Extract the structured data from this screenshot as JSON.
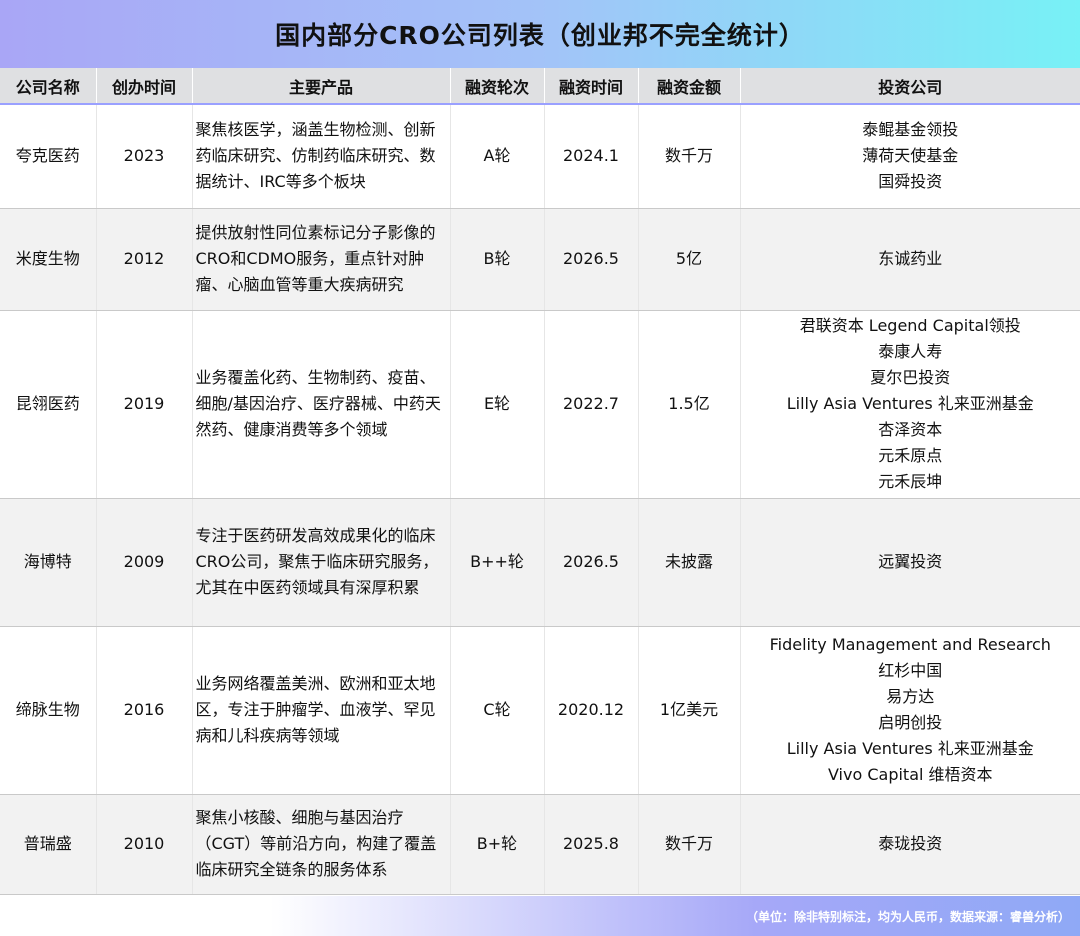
{
  "title": "国内部分CRO公司列表（创业邦不完全统计）",
  "headers": [
    "公司名称",
    "创办时间",
    "主要产品",
    "融资轮次",
    "融资时间",
    "融资金额",
    "投资公司"
  ],
  "rows": [
    {
      "company": "夸克医药",
      "founded": "2023",
      "product": "聚焦核医学，涵盖生物检测、创新药临床研究、仿制药临床研究、数据统计、IRC等多个板块",
      "round": "A轮",
      "date": "2024.1",
      "amount": "数千万",
      "investors": [
        "泰鲲基金领投",
        "薄荷天使基金",
        "国舜投资"
      ]
    },
    {
      "company": "米度生物",
      "founded": "2012",
      "product": "提供放射性同位素标记分子影像的CRO和CDMO服务，重点针对肿瘤、心脑血管等重大疾病研究",
      "round": "B轮",
      "date": "2026.5",
      "amount": "5亿",
      "investors": [
        "东诚药业"
      ]
    },
    {
      "company": "昆翎医药",
      "founded": "2019",
      "product": "业务覆盖化药、生物制药、疫苗、细胞/基因治疗、医疗器械、中药天然药、健康消费等多个领域",
      "round": "E轮",
      "date": "2022.7",
      "amount": "1.5亿",
      "investors": [
        "君联资本 Legend Capital领投",
        "泰康人寿",
        "夏尔巴投资",
        "Lilly Asia Ventures 礼来亚洲基金",
        "杏泽资本",
        "元禾原点",
        "元禾辰坤"
      ]
    },
    {
      "company": "海博特",
      "founded": "2009",
      "product": "专注于医药研发高效成果化的临床CRO公司，聚焦于临床研究服务，尤其在中医药领域具有深厚积累",
      "round": "B++轮",
      "date": "2026.5",
      "amount": "未披露",
      "investors": [
        "远翼投资"
      ]
    },
    {
      "company": "缔脉生物",
      "founded": "2016",
      "product": "业务网络覆盖美洲、欧洲和亚太地区，专注于肿瘤学、血液学、罕见病和儿科疾病等领域",
      "round": "C轮",
      "date": "2020.12",
      "amount": "1亿美元",
      "investors": [
        "Fidelity Management and Research",
        "红杉中国",
        "易方达",
        "启明创投",
        "Lilly Asia Ventures 礼来亚洲基金",
        "Vivo Capital 维梧资本"
      ]
    },
    {
      "company": "普瑞盛",
      "founded": "2010",
      "product": "聚焦小核酸、细胞与基因治疗（CGT）等前沿方向，构建了覆盖临床研究全链条的服务体系",
      "round": "B+轮",
      "date": "2025.8",
      "amount": "数千万",
      "investors": [
        "泰珑投资"
      ]
    }
  ],
  "footer": "（单位：除非特别标注，均为人民币，数据来源：睿兽分析）"
}
